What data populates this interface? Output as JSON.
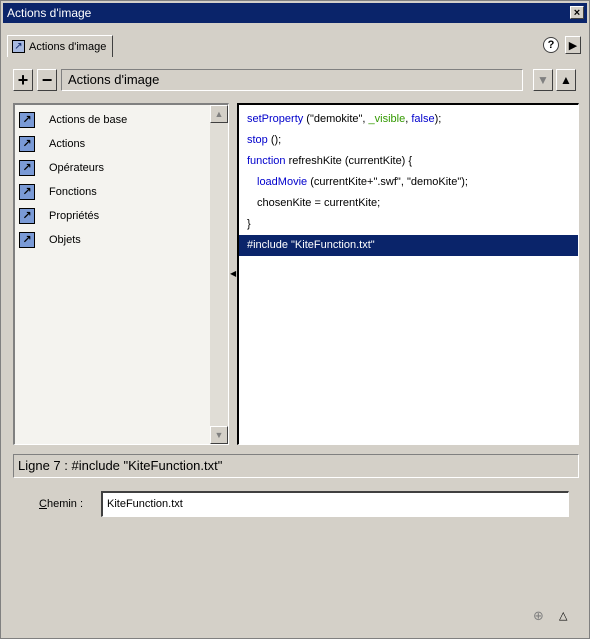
{
  "window": {
    "title": "Actions d'image"
  },
  "tab": {
    "label": "Actions d'image",
    "help": "?"
  },
  "toolbar": {
    "add": "+",
    "remove": "−",
    "title": "Actions d'image"
  },
  "tree": {
    "items": [
      {
        "label": "Actions de base",
        "icon": "book-icon"
      },
      {
        "label": "Actions",
        "icon": "book-icon"
      },
      {
        "label": "Opérateurs",
        "icon": "book-icon"
      },
      {
        "label": "Fonctions",
        "icon": "book-icon"
      },
      {
        "label": "Propriétés",
        "icon": "book-icon"
      },
      {
        "label": "Objets",
        "icon": "book-icon"
      }
    ]
  },
  "code": {
    "lines": [
      {
        "k1": "setProperty",
        "t1": " (\"demokite\", ",
        "k2": "_visible",
        "t2": ", ",
        "k3": "false",
        "t3": ");"
      },
      {
        "k1": "stop",
        "t1": " ();"
      },
      {
        "k1": "function",
        "t1": " refreshKite (currentKite) {"
      },
      {
        "k1": "loadMovie",
        "t1": " (currentKite+\".swf\", \"demoKite\");"
      },
      {
        "t1": "chosenKite = currentKite;"
      },
      {
        "t1": "}"
      },
      {
        "t1": "#include \"KiteFunction.txt\""
      }
    ]
  },
  "status": {
    "text": "Ligne 7 : #include \"KiteFunction.txt\""
  },
  "path": {
    "label_c": "C",
    "label_rest": "hemin :",
    "value": "KiteFunction.txt"
  },
  "colors": {
    "titlebar": "#0a246a",
    "selection": "#0a246a",
    "keyword": "#0000cc",
    "property": "#339900"
  }
}
